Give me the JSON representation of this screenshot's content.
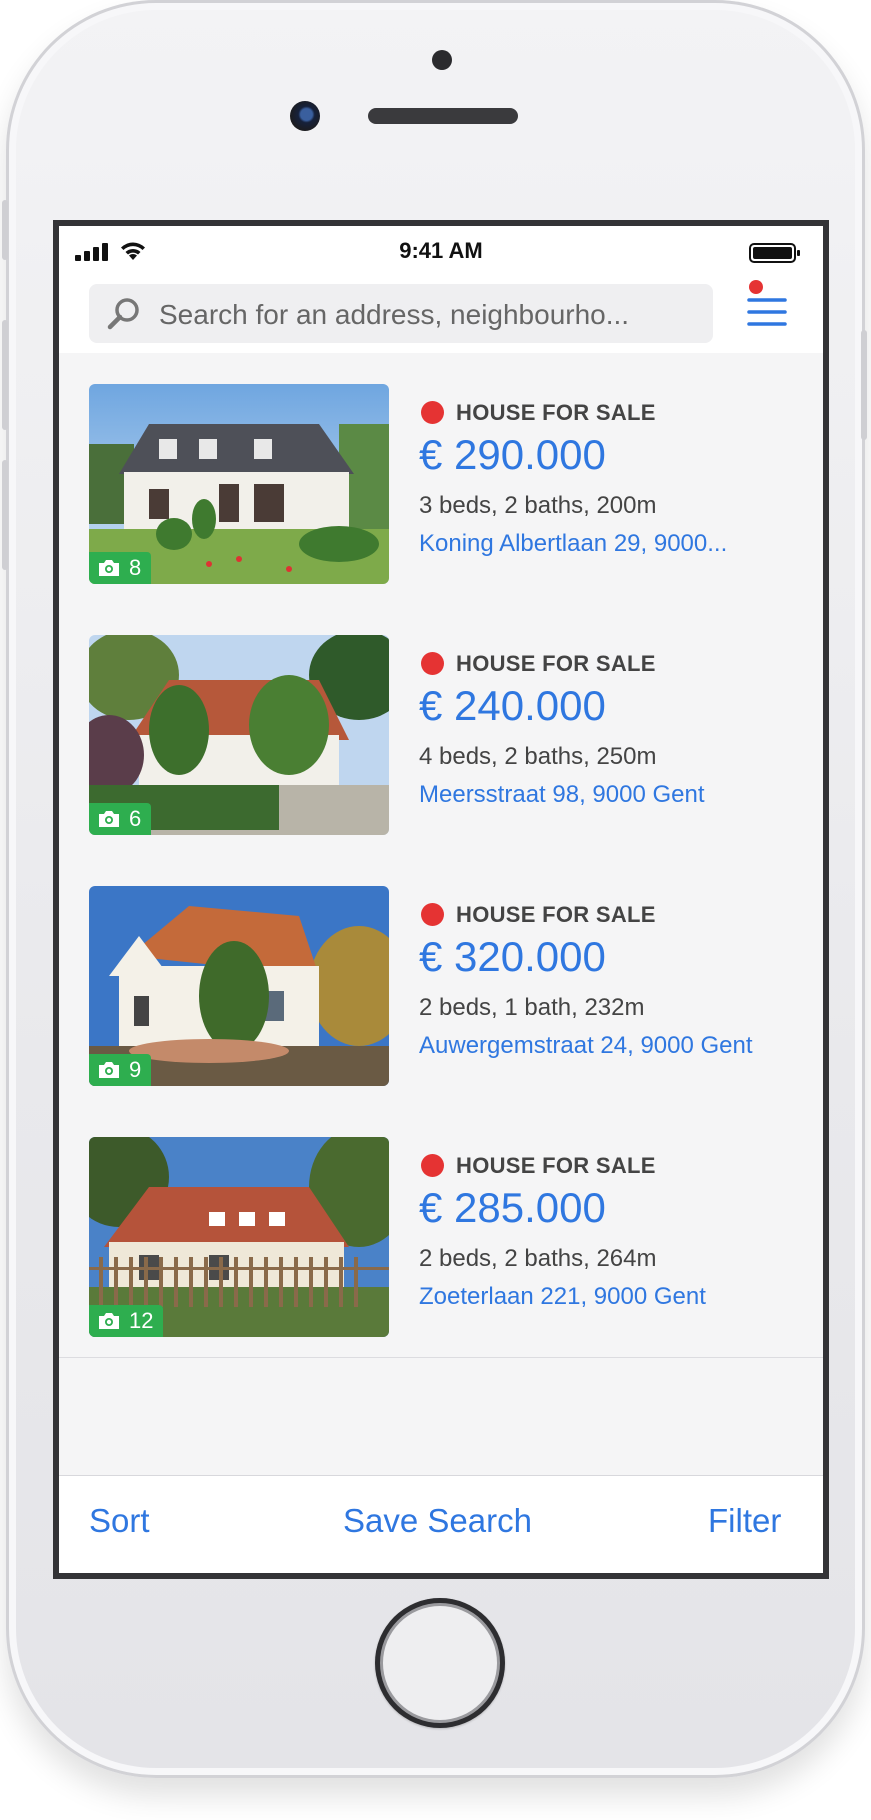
{
  "statusbar": {
    "time": "9:41 AM"
  },
  "search": {
    "placeholder": "Search for an address, neighbourho..."
  },
  "listings": [
    {
      "type": "HOUSE FOR SALE",
      "price": "€ 290.000",
      "specs": "3 beds, 2 baths, 200m",
      "address": "Koning Albertlaan 29, 9000...",
      "photos": "8"
    },
    {
      "type": "HOUSE FOR SALE",
      "price": "€ 240.000",
      "specs": "4 beds, 2 baths, 250m",
      "address": "Meersstraat 98, 9000 Gent",
      "photos": "6"
    },
    {
      "type": "HOUSE FOR SALE",
      "price": "€ 320.000",
      "specs": "2 beds, 1 bath, 232m",
      "address": "Auwergemstraat 24, 9000 Gent",
      "photos": "9"
    },
    {
      "type": "HOUSE FOR SALE",
      "price": "€ 285.000",
      "specs": "2 beds, 2 baths, 264m",
      "address": "Zoeterlaan 221, 9000 Gent",
      "photos": "12"
    }
  ],
  "bottombar": {
    "sort": "Sort",
    "save_search": "Save Search",
    "filter": "Filter"
  },
  "colors": {
    "accent": "#2f77e0",
    "status_red": "#e53333",
    "photo_badge_green": "#2eae4f"
  },
  "icons": [
    "search-icon",
    "menu-icon",
    "camera-icon",
    "signal-icon",
    "wifi-icon",
    "battery-icon"
  ]
}
